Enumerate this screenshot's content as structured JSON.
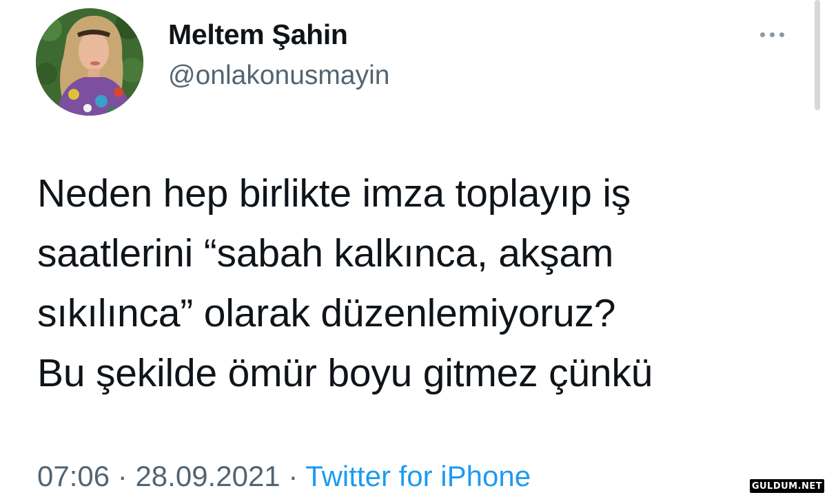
{
  "author": {
    "display_name": "Meltem Şahin",
    "handle": "@onlakonusmayin",
    "avatar_icon": "profile-photo"
  },
  "more_icon": "more-horizontal-icon",
  "tweet": {
    "lines": [
      "Neden hep birlikte imza toplayıp iş",
      "saatlerini “sabah kalkınca, akşam",
      "sıkılınca” olarak düzenlemiyoruz?",
      "Bu şekilde ömür boyu gitmez çünkü"
    ]
  },
  "meta": {
    "time": "07:06",
    "separator": "·",
    "date": "28.09.2021",
    "source": "Twitter for iPhone"
  },
  "watermark": "GULDUM.NET",
  "colors": {
    "text": "#0f1419",
    "secondary": "#536471",
    "link": "#1d9bf0",
    "background": "#ffffff"
  }
}
